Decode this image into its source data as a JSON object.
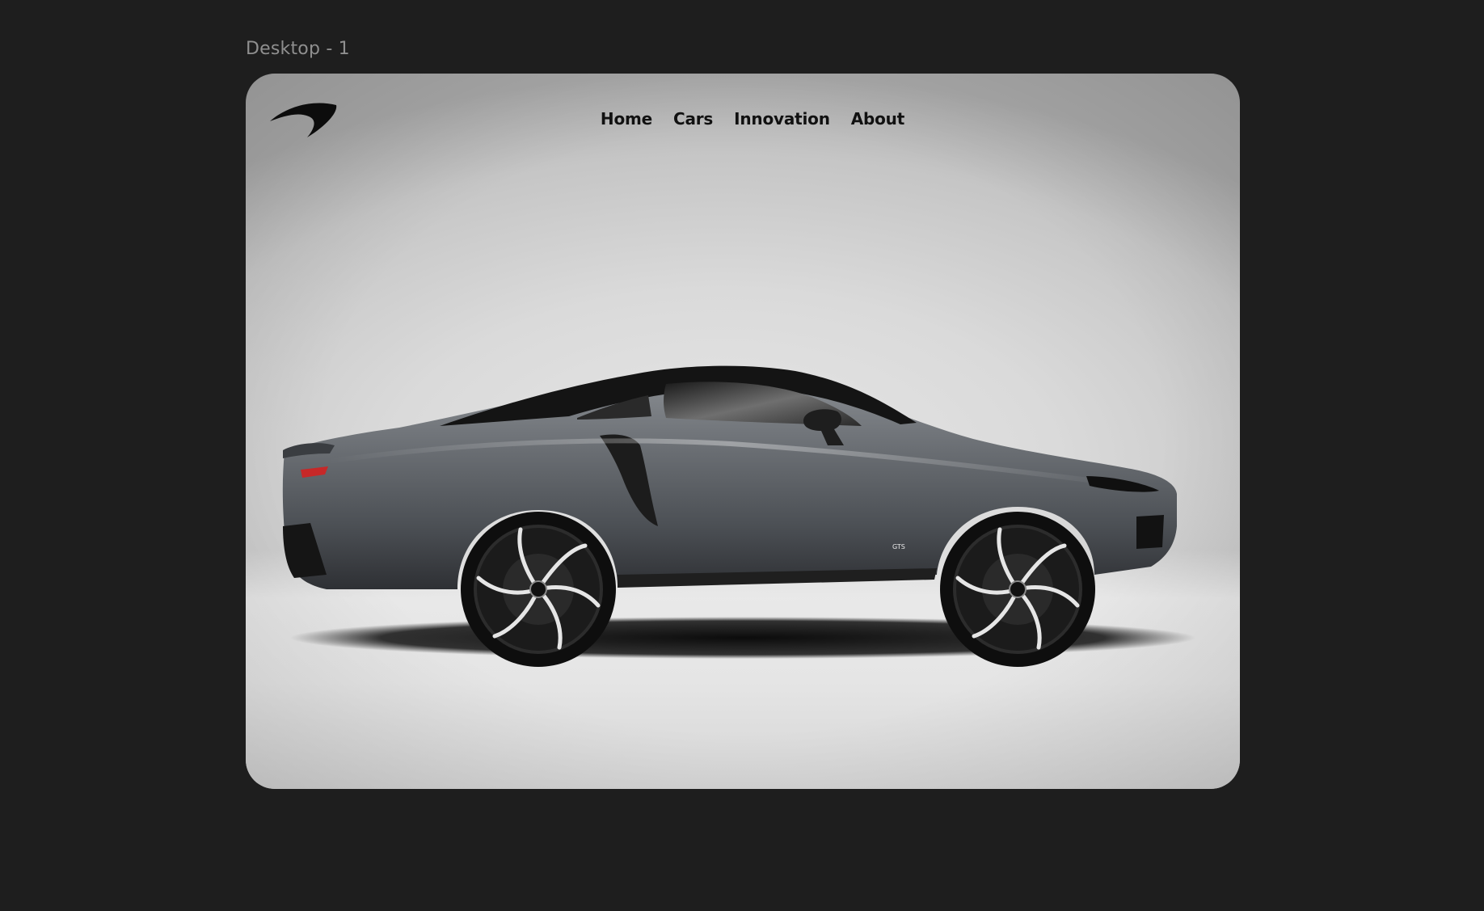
{
  "frame_label": "Desktop - 1",
  "logo": {
    "icon": "mclaren-speedmark-icon"
  },
  "nav": {
    "items": [
      {
        "label": "Home"
      },
      {
        "label": "Cars"
      },
      {
        "label": "Innovation"
      },
      {
        "label": "About"
      }
    ]
  },
  "hero": {
    "image": "grey-supercar-side-profile",
    "badge_text": "GTS"
  },
  "colors": {
    "canvas_bg": "#1e1e1e",
    "frame_bg": "#dcdcdc",
    "nav_text": "#111111",
    "label_text": "#8f8f8f",
    "car_body": "#5d6166"
  }
}
